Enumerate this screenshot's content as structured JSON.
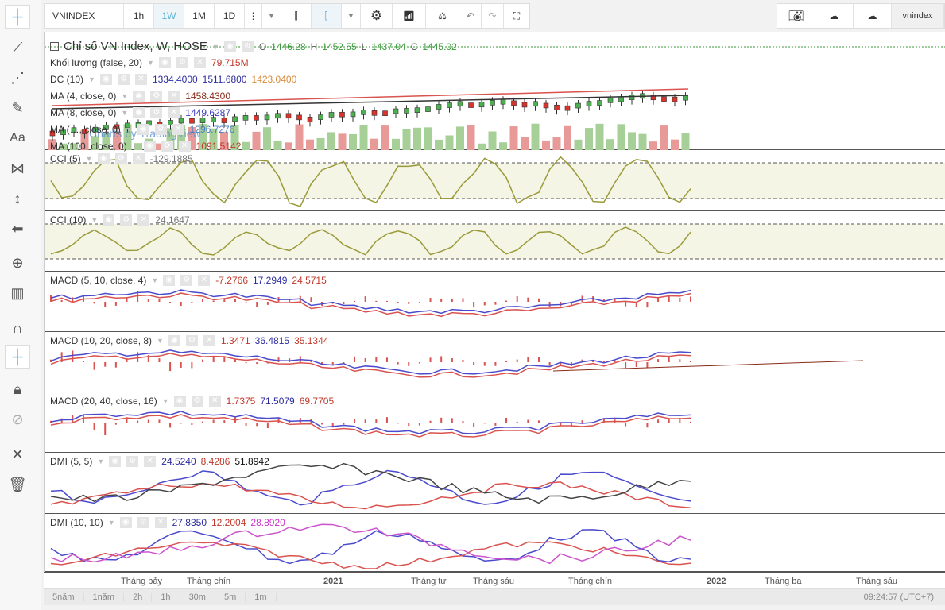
{
  "toolbar": {
    "symbol": "VNINDEX",
    "intervals": [
      "1h",
      "1W",
      "1M",
      "1D"
    ],
    "active_interval": "1W",
    "user": "vnindex"
  },
  "main": {
    "title": "Chỉ số VN Index, W, HOSE",
    "ohlc": {
      "o_label": "O",
      "o": "1446.28",
      "h_label": "H",
      "h": "1452.55",
      "l_label": "L",
      "l": "1437.04",
      "c_label": "C",
      "c": "1445.02"
    },
    "indicators": [
      {
        "name": "Khối lượng (false, 20)",
        "values": [
          "79.715M"
        ]
      },
      {
        "name": "DC (10)",
        "values": [
          "1334.4000",
          "1511.6800",
          "1423.0400"
        ]
      },
      {
        "name": "MA (4, close, 0)",
        "values": [
          "1458.4300"
        ]
      },
      {
        "name": "MA (8, close, 0)",
        "values": [
          "1449.6287"
        ]
      },
      {
        "name": "MA (…, close, 0)",
        "values": [
          "1296.7276"
        ]
      },
      {
        "name": "MA (100, close, 0)",
        "values": [
          "1091.5142"
        ]
      }
    ],
    "watermark": "Charts by TradingView"
  },
  "panes": [
    {
      "name": "CCI (5)",
      "values": [
        "-129.1885"
      ]
    },
    {
      "name": "CCI (10)",
      "values": [
        "24.1647"
      ]
    },
    {
      "name": "MACD (5, 10, close, 4)",
      "values": [
        "-7.2766",
        "17.2949",
        "24.5715"
      ]
    },
    {
      "name": "MACD (10, 20, close, 8)",
      "values": [
        "1.3471",
        "36.4815",
        "35.1344"
      ]
    },
    {
      "name": "MACD (20, 40, close, 16)",
      "values": [
        "1.7375",
        "71.5079",
        "69.7705"
      ]
    },
    {
      "name": "DMI (5, 5)",
      "values": [
        "24.5240",
        "8.4286",
        "51.8942"
      ]
    },
    {
      "name": "DMI (10, 10)",
      "values": [
        "27.8350",
        "12.2004",
        "28.8920"
      ]
    }
  ],
  "time_axis": [
    "Tháng bảy",
    "Tháng chín",
    "2021",
    "Tháng tư",
    "Tháng sáu",
    "Tháng chín",
    "2022",
    "Tháng ba",
    "Tháng sáu"
  ],
  "ranges": [
    "5năm",
    "1năm",
    "2h",
    "1h",
    "30m",
    "5m",
    "1m"
  ],
  "clock": "09:24:57 (UTC+7)",
  "colors": {
    "up": "#6aa84f",
    "down": "#d9534f",
    "blue": "#3d3dbf",
    "red": "#d9534f",
    "olive": "#9a9a3a",
    "magenta": "#cc33cc"
  }
}
